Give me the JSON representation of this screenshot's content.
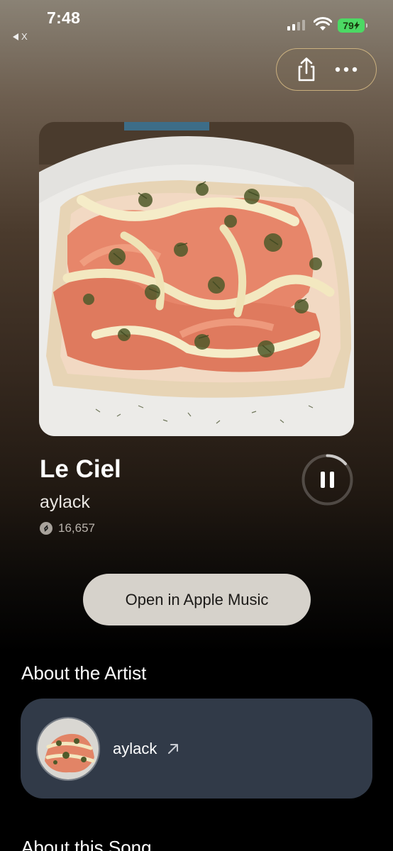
{
  "status_bar": {
    "time": "7:48",
    "back_label": "X",
    "battery": "79"
  },
  "toolbar": {
    "share_icon": "share-icon",
    "more_icon": "more-icon"
  },
  "track": {
    "title": "Le Ciel",
    "artist": "aylack",
    "shazam_count": "16,657",
    "playback_state": "playing"
  },
  "actions": {
    "open_in_music": "Open in Apple Music"
  },
  "about_artist": {
    "heading": "About the Artist",
    "artist_name": "aylack"
  },
  "about_song": {
    "heading": "About this Song"
  },
  "colors": {
    "pill_border": "#e6c88c",
    "card_bg": "#313a48",
    "button_bg": "#d6d2cb",
    "battery_green": "#4cd964"
  }
}
